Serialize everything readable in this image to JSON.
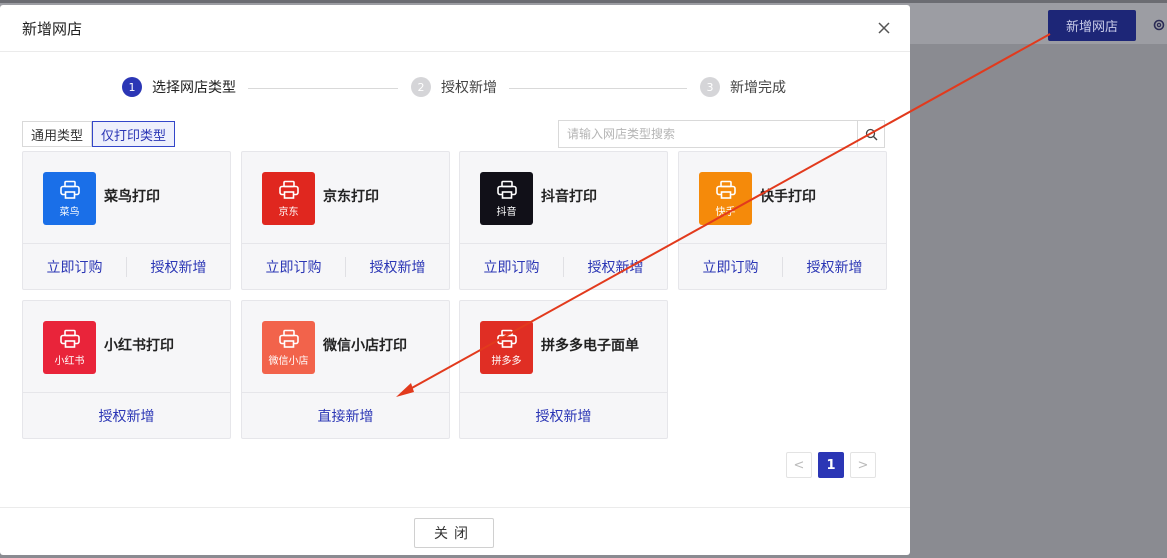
{
  "header_bar": {
    "add_shop_label": "新增网店"
  },
  "modal": {
    "title": "新增网店",
    "steps": [
      {
        "num": "1",
        "label": "选择网店类型",
        "active": true
      },
      {
        "num": "2",
        "label": "授权新增",
        "active": false
      },
      {
        "num": "3",
        "label": "新增完成",
        "active": false
      }
    ],
    "type_tabs": [
      {
        "label": "通用类型",
        "active": false
      },
      {
        "label": "仅打印类型",
        "active": true
      }
    ],
    "search": {
      "placeholder": "请输入网店类型搜索"
    },
    "cards": [
      {
        "name": "菜鸟打印",
        "brand": "菜鸟",
        "brand_icon": "cainiao-logo-icon",
        "color": "#1a6fe8",
        "actions": [
          "立即订购",
          "授权新增"
        ]
      },
      {
        "name": "京东打印",
        "brand": "京东",
        "brand_icon": "jd-logo-icon",
        "color": "#e0271f",
        "actions": [
          "立即订购",
          "授权新增"
        ]
      },
      {
        "name": "抖音打印",
        "brand": "抖音",
        "brand_icon": "douyin-logo-icon",
        "color": "#111018",
        "actions": [
          "立即订购",
          "授权新增"
        ]
      },
      {
        "name": "快手打印",
        "brand": "快手",
        "brand_icon": "kuaishou-logo-icon",
        "color": "#f58a0a",
        "actions": [
          "立即订购",
          "授权新增"
        ]
      },
      {
        "name": "小红书打印",
        "brand": "小红书",
        "brand_icon": "xiaohongshu-logo-icon",
        "color": "#e9243a",
        "actions": [
          "授权新增"
        ]
      },
      {
        "name": "微信小店打印",
        "brand": "微信小店",
        "brand_icon": "weixin-shop-logo-icon",
        "color": "#f2634b",
        "actions": [
          "直接新增"
        ]
      },
      {
        "name": "拼多多电子面单",
        "brand": "拼多多",
        "brand_icon": "pinduoduo-logo-icon",
        "color": "#e02e24",
        "actions": [
          "授权新增"
        ]
      }
    ],
    "pagination": {
      "prev": "<",
      "current": "1",
      "next": ">"
    },
    "close_label": "关闭"
  },
  "colors": {
    "accent": "#2b36b5",
    "annotation_arrow": "#e23a1d"
  }
}
